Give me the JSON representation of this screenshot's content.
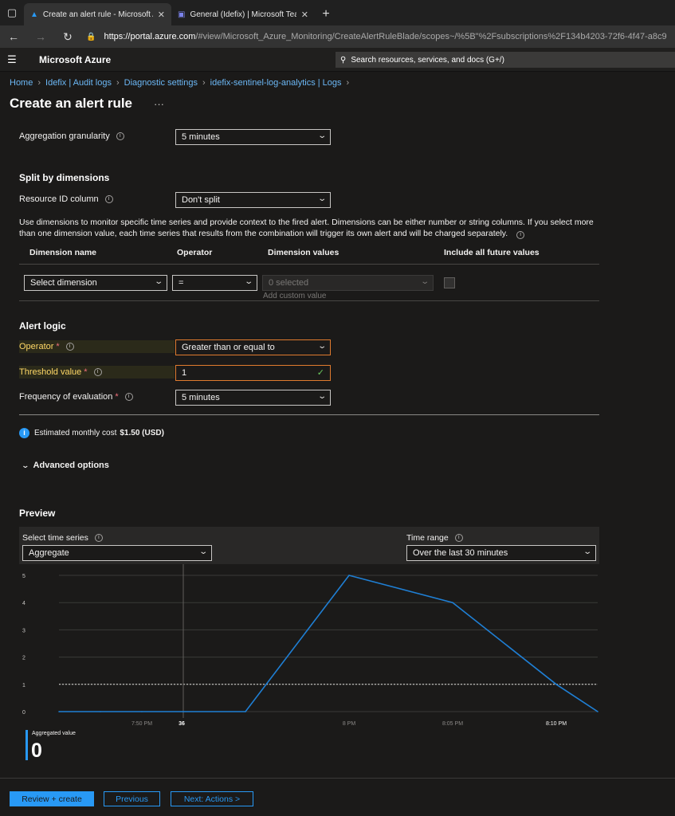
{
  "browser": {
    "tabs": [
      {
        "title": "Create an alert rule - Microsoft Azure",
        "active": true
      },
      {
        "title": "General (Idefix) | Microsoft Teams",
        "active": false
      }
    ],
    "url_host": "https://portal.azure.com",
    "url_rest": "/#view/Microsoft_Azure_Monitoring/CreateAlertRuleBlade/scopes~/%5B\"%2Fsubscriptions%2F134b4203-72f6-4f47-a8c9"
  },
  "header": {
    "brand": "Microsoft Azure",
    "search_placeholder": "Search resources, services, and docs (G+/)"
  },
  "breadcrumb": [
    "Home",
    "Idefix | Audit logs",
    "Diagnostic settings",
    "idefix-sentinel-log-analytics | Logs"
  ],
  "page_title": "Create an alert rule",
  "title_more": "···",
  "aggregation": {
    "label": "Aggregation granularity",
    "value": "5 minutes"
  },
  "split": {
    "heading": "Split by dimensions",
    "resource_label": "Resource ID column",
    "resource_value": "Don't split",
    "description": "Use dimensions to monitor specific time series and provide context to the fired alert. Dimensions can be either number or string columns. If you select more than one dimension value, each time series that results from the combination will trigger its own alert and will be charged separately.",
    "columns": [
      "Dimension name",
      "Operator",
      "Dimension values",
      "Include all future values"
    ],
    "dimension_placeholder": "Select dimension",
    "operator_value": "=",
    "values_placeholder": "0 selected",
    "add_custom": "Add custom value"
  },
  "alert_logic": {
    "heading": "Alert logic",
    "operator_label": "Operator",
    "operator_value": "Greater than or equal to",
    "threshold_label": "Threshold value",
    "threshold_value": "1",
    "frequency_label": "Frequency of evaluation",
    "frequency_value": "5 minutes",
    "required_mark": "*"
  },
  "cost": {
    "text": "Estimated monthly cost",
    "amount": "$1.50 (USD)"
  },
  "advanced": "Advanced options",
  "preview": {
    "heading": "Preview",
    "series_label": "Select time series",
    "series_value": "Aggregate",
    "range_label": "Time range",
    "range_value": "Over the last 30 minutes",
    "agg_label": "Aggregated value",
    "agg_value": "0"
  },
  "footer": {
    "review": "Review + create",
    "previous": "Previous",
    "next": "Next: Actions >"
  },
  "colors": {
    "accent": "#2899f5",
    "line": "#1f7fd4",
    "warn": "#e07b2e",
    "highlight": "#ffd866"
  },
  "chart_data": {
    "type": "line",
    "series": [
      {
        "x": [
          "7:46 PM",
          "7:48 PM",
          "7:50 PM",
          "7:52 PM",
          "7:55 PM",
          "8:00 PM",
          "8:05 PM",
          "8:10 PM",
          "8:12 PM"
        ],
        "values": [
          0,
          0,
          0,
          0,
          0,
          5,
          4,
          1,
          0
        ]
      }
    ],
    "threshold": 1,
    "yticks": [
      0,
      1,
      2,
      3,
      4,
      5
    ],
    "ylim": [
      0,
      5
    ],
    "xtick_labels": [
      "7:50 PM",
      "8 PM",
      "8:05 PM",
      "8:10 PM"
    ],
    "cursor_label": "36",
    "grid": true
  }
}
